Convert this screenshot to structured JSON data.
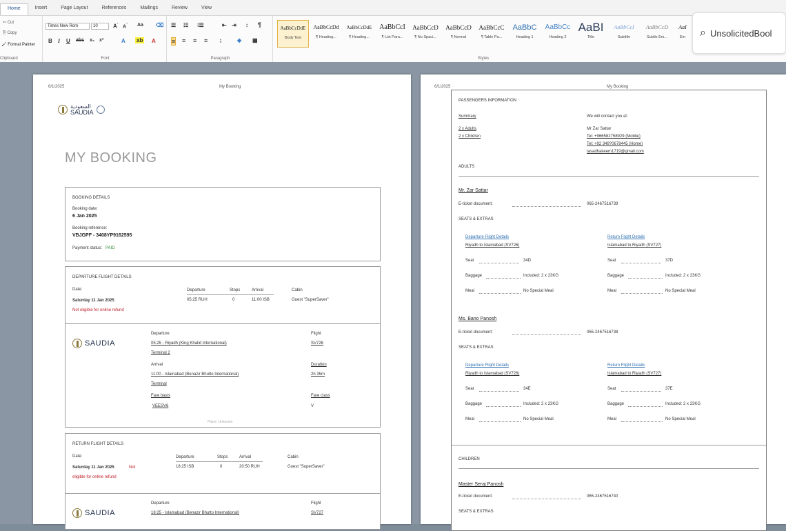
{
  "ribbon": {
    "tabs": [
      "Home",
      "Insert",
      "Page Layout",
      "References",
      "Mailings",
      "Review",
      "View"
    ],
    "clipboard": {
      "cut": "Cut",
      "copy": "Copy",
      "format_painter": "Format Painter",
      "label": "Clipboard"
    },
    "font": {
      "name": "Times New Rom",
      "size": "10",
      "label": "Font"
    },
    "paragraph_label": "Paragraph",
    "styles_label": "Styles",
    "styles": [
      {
        "sample": "AaBbCcDdE",
        "name": "Body Text"
      },
      {
        "sample": "AaBbCcDd",
        "name": "¶ Heading..."
      },
      {
        "sample": "AaBbCcDdE",
        "name": "¶ Heading..."
      },
      {
        "sample": "AaBbCcI",
        "name": "¶ List Para..."
      },
      {
        "sample": "AaBbCcD",
        "name": "¶ No Spaci..."
      },
      {
        "sample": "AaBbCcD",
        "name": "¶ Normal"
      },
      {
        "sample": "AaBbCcC",
        "name": "¶ Table Pa..."
      },
      {
        "sample": "AaBbC",
        "name": "Heading 1"
      },
      {
        "sample": "AaBbCc",
        "name": "Heading 2"
      },
      {
        "sample": "AaBI",
        "name": "Title"
      },
      {
        "sample": "AaBbCcI",
        "name": "Subtitle"
      },
      {
        "sample": "AaBbCcD",
        "name": "Subtle Em..."
      },
      {
        "sample": "AaI",
        "name": "Em"
      }
    ],
    "search_text": "UnsolicitedBool"
  },
  "page1": {
    "header_date": "6/1/2025",
    "header_title": "My Booking",
    "logo_arabic": "السعودية",
    "logo_text": "SAUDIA",
    "title": "MY BOOKING",
    "booking": {
      "heading": "BOOKING DETAILS",
      "date_label": "Booking date:",
      "date": "6 Jan 2025",
      "ref_label": "Booking reference:",
      "ref": "VBJGPF - 3408YP9162595",
      "payment_label": "Payment status:",
      "payment": "PAID"
    },
    "departure": {
      "heading": "DEPARTURE FLIGHT DETAILS",
      "date_label": "Date:",
      "date": "Saturday 11 Jan 2025",
      "not_eligible": "Not eligible for online refund",
      "cols": [
        "Departure",
        "Stops",
        "Arrival",
        "Cabin"
      ],
      "row": [
        "05:25 RUH",
        "0",
        "11:00 ISB",
        "Guest \"SuperSaver\""
      ],
      "airline": "SAUDIA",
      "departure_label": "Departure",
      "departure_value": "05:25 - Riyadh (King Khalid International)",
      "terminal_dep": "Terminal 2",
      "arrival_label": "Arrival",
      "arrival_value": "11:00 - Islamabad (Benazir Bhutto International)",
      "terminal_arr": "Terminal",
      "fare_basis_label": "Fare basis",
      "fare_basis": "VEESV6",
      "flight_label": "Flight",
      "flight": "SV726",
      "duration_label": "Duration",
      "duration": "2h 35m",
      "fare_class_label": "Fare class",
      "fare_class": "V",
      "footer": "Plane: Unknown"
    },
    "return": {
      "heading": "RETURN FLIGHT DETAILS",
      "date_label": "Date:",
      "date": "Saturday 11 Jan 2025",
      "not_eligible_1": "Not",
      "not_eligible_2": "eligible for online refund",
      "cols": [
        "Departure",
        "Stops",
        "Arrival",
        "Cabin"
      ],
      "row": [
        "18:25 ISB",
        "0",
        "20:50 RUH",
        "Guest \"SuperSaver\""
      ],
      "airline": "SAUDIA",
      "departure_label": "Departure",
      "departure_value": "18:25 - Islamabad (Benazir Bhutto International)",
      "flight_label": "Flight",
      "flight": "SV727"
    }
  },
  "page2": {
    "header_date": "6/1/2025",
    "header_title": "My Booking",
    "passengers_heading": "PASSENGERS INFORMATION",
    "summary_label": "Summary",
    "summary_1": "2 x Adults",
    "summary_2": "2 x Children",
    "contact_label": "We will contact you at:",
    "contact_name": "Mr Zar Sattar",
    "contact_mobile": "Tel: +966582758929 (Mobile)",
    "contact_home": "Tel: +92 348?0678445 (Home)",
    "contact_email": "tasadhakeem1719@gmail.com",
    "adults_heading": "ADULTS",
    "children_heading": "CHILDREN",
    "passengers": [
      {
        "name": "Mr. Zar Sattar",
        "ticket_label": "E-ticket document:",
        "ticket": "065-2467516739",
        "seats_heading": "SEATS & EXTRAS",
        "dep_title": "Departure Flight Details",
        "dep_route": "Riyadh to Islamabad (SV726)",
        "ret_title": "Return Flight Details",
        "ret_route": "Islamabad to Riyadh (SV727)",
        "seat_label": "Seat",
        "dep_seat": "34D",
        "ret_seat": "37D",
        "baggage_label": "Baggage",
        "dep_baggage": "Included: 2 x 23KG",
        "ret_baggage": "Included: 2 x 23KG",
        "meal_label": "Meal",
        "dep_meal": "No Special Meal",
        "ret_meal": "No Special Meal"
      },
      {
        "name": "Ms. Bano Panosh",
        "ticket_label": "E-ticket document:",
        "ticket": "065-2467516738",
        "seats_heading": "SEATS & EXTRAS",
        "dep_title": "Departure Flight Details",
        "dep_route": "Riyadh to Islamabad (SV726)",
        "ret_title": "Return Flight Details",
        "ret_route": "Islamabad to Riyadh (SV727)",
        "seat_label": "Seat",
        "dep_seat": "34E",
        "ret_seat": "37E",
        "baggage_label": "Baggage",
        "dep_baggage": "Included: 2 x 23KG",
        "ret_baggage": "Included: 2 x 23KG",
        "meal_label": "Meal",
        "dep_meal": "No Special Meal",
        "ret_meal": "No Special Meal"
      }
    ],
    "child": {
      "name": "Master Seraj Panosh",
      "ticket_label": "E-ticket document:",
      "ticket": "065-2467516740",
      "seats_heading": "SEATS & EXTRAS"
    }
  }
}
